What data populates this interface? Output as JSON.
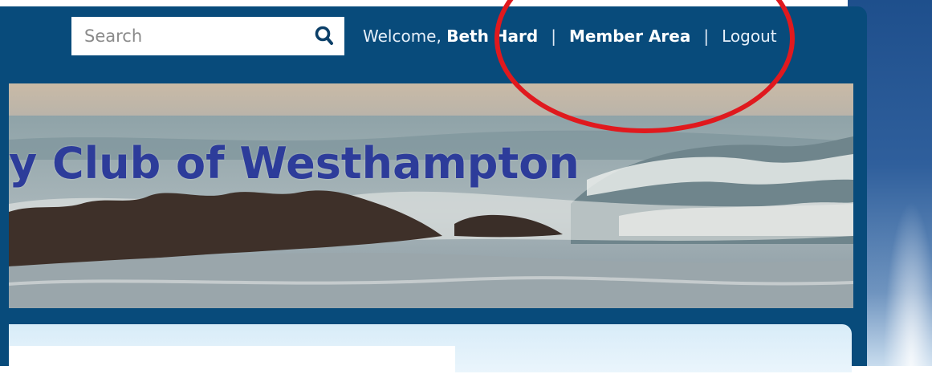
{
  "header": {
    "search": {
      "placeholder": "Search",
      "value": ""
    },
    "welcome_prefix": "Welcome,",
    "user_name": "Beth Hard",
    "separator": "|",
    "member_area_label": "Member Area",
    "logout_label": "Logout"
  },
  "banner": {
    "title": "y Club of Westhampton"
  },
  "colors": {
    "frame": "#084b7b",
    "title": "#2d3c9a",
    "annotation": "#e0191e"
  },
  "icons": {
    "search": "search-icon"
  }
}
